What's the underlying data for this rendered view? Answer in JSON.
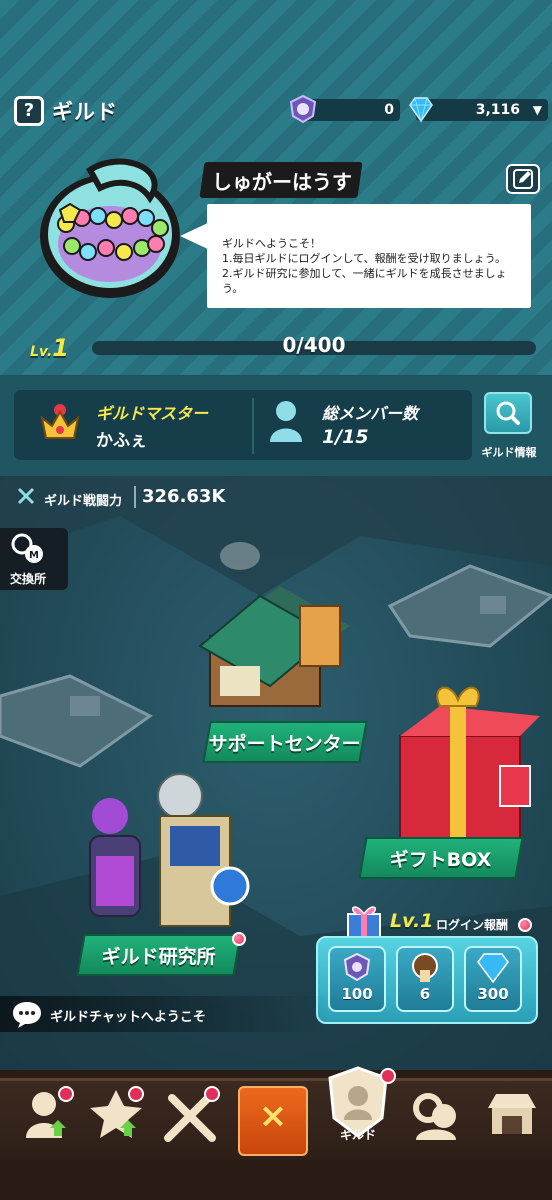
{
  "header": {
    "help_icon": "?",
    "title": "ギルド",
    "medal_count": "0",
    "gem_count": "3,116"
  },
  "guild": {
    "name": "しゅがーはうす",
    "message_line1": "ギルドへようこそ！",
    "message_line2": "1.毎日ギルドにログインして、報酬を受け取りましょう。",
    "message_line3": "2.ギルド研究に参加して、一緒にギルドを成長させましょう。",
    "level_prefix": "Lv.",
    "level": "1",
    "xp_text": "0/400",
    "xp_progress": 0.0
  },
  "info": {
    "master_label": "ギルドマスター",
    "master_name": "かふぇ",
    "members_label": "総メンバー数",
    "members_count": "1/15",
    "info_button": "ギルド情報"
  },
  "map": {
    "power_label": "ギルド戦闘力",
    "power_value": "326.63K",
    "exchange_label": "交換所",
    "support_center": "サポートセンター",
    "gift_box": "ギフトBOX",
    "research": "ギルド研究所",
    "chat_text": "ギルドチャットへようこそ"
  },
  "login_reward": {
    "level": "Lv.1",
    "title": "ログイン報酬",
    "items": [
      {
        "icon": "guild-medal-icon",
        "amount": "100"
      },
      {
        "icon": "cookie-key-icon",
        "amount": "6"
      },
      {
        "icon": "crystal-gem-icon",
        "amount": "300"
      }
    ]
  },
  "nav": {
    "close_icon": "×",
    "guild_label": "ギルド"
  },
  "colors": {
    "accent_yellow": "#f5e84a",
    "building_label_green": "#20b27a",
    "close_orange": "#ec6a1e",
    "badge_red": "#e0305a"
  }
}
